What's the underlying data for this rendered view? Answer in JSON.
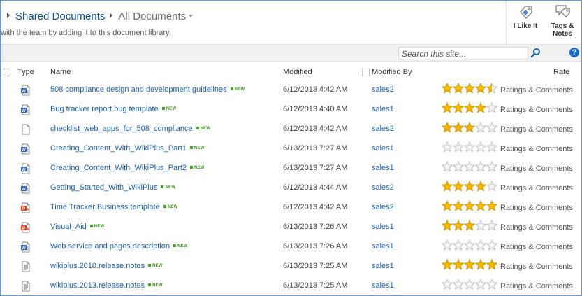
{
  "header": {
    "breadcrumb_library": "Shared Documents",
    "breadcrumb_view": "All Documents",
    "description": "with the team by adding it to this document library.",
    "i_like_it_label": "I Like It",
    "tags_notes_label_1": "Tags &",
    "tags_notes_label_2": "Notes"
  },
  "search": {
    "placeholder": "Search this site...",
    "help_label": "?"
  },
  "columns": {
    "type": "Type",
    "name": "Name",
    "modified": "Modified",
    "modified_by": "Modified By",
    "rate": "Rate"
  },
  "colors": {
    "accent": "#1f5fa8",
    "star": "#f5b800",
    "new_badge": "#3cae1f"
  },
  "rows": [
    {
      "icon": "word-doc-icon",
      "name": "508 compliance design and development guidelines",
      "new": "NEW",
      "modified": "6/12/2013 4:42 AM",
      "modified_by": "sales2",
      "rating": 4.5,
      "ratings_label": "Ratings & Comments"
    },
    {
      "icon": "word-doc-icon",
      "name": "Bug tracker report bug template",
      "new": "NEW",
      "modified": "6/12/2013 4:40 AM",
      "modified_by": "sales1",
      "rating": 4,
      "ratings_label": "Ratings & Comments"
    },
    {
      "icon": "blank-doc-icon",
      "name": "checklist_web_apps_for_508_compliance",
      "new": "NEW",
      "modified": "6/12/2013 4:42 AM",
      "modified_by": "sales2",
      "rating": 3,
      "ratings_label": "Ratings & Comments"
    },
    {
      "icon": "word-doc-icon",
      "name": "Creating_Content_With_WikiPlus_Part1",
      "new": "NEW",
      "modified": "6/13/2013 7:27 AM",
      "modified_by": "sales1",
      "rating": 0,
      "ratings_label": "Ratings & Comments"
    },
    {
      "icon": "word-doc-icon",
      "name": "Creating_Content_With_WikiPlus_Part2",
      "new": "NEW",
      "modified": "6/13/2013 7:27 AM",
      "modified_by": "sales1",
      "rating": 0,
      "ratings_label": "Ratings & Comments"
    },
    {
      "icon": "word-doc-icon",
      "name": "Getting_Started_With_WikiPlus",
      "new": "NEW",
      "modified": "6/12/2013 4:44 AM",
      "modified_by": "sales2",
      "rating": 4,
      "ratings_label": "Ratings & Comments"
    },
    {
      "icon": "powerpoint-doc-icon",
      "name": "Time Tracker Business template",
      "new": "NEW",
      "modified": "6/12/2013 4:42 AM",
      "modified_by": "sales2",
      "rating": 5,
      "ratings_label": "Ratings & Comments"
    },
    {
      "icon": "powerpoint-doc-icon",
      "name": "Visual_Aid",
      "new": "NEW",
      "modified": "6/13/2013 7:26 AM",
      "modified_by": "sales1",
      "rating": 3,
      "ratings_label": "Ratings & Comments"
    },
    {
      "icon": "word-doc-icon",
      "name": "Web service and pages description",
      "new": "NEW",
      "modified": "6/13/2013 7:26 AM",
      "modified_by": "sales1",
      "rating": 0,
      "ratings_label": "Ratings & Comments"
    },
    {
      "icon": "text-doc-icon",
      "name": "wikiplus.2010.release.notes",
      "new": "NEW",
      "modified": "6/13/2013 7:25 AM",
      "modified_by": "sales1",
      "rating": 5,
      "ratings_label": "Ratings & Comments"
    },
    {
      "icon": "text-doc-icon",
      "name": "wikiplus.2013.release.notes",
      "new": "NEW",
      "modified": "6/13/2013 7:25 AM",
      "modified_by": "sales1",
      "rating": 0,
      "ratings_label": "Ratings & Comments"
    }
  ]
}
